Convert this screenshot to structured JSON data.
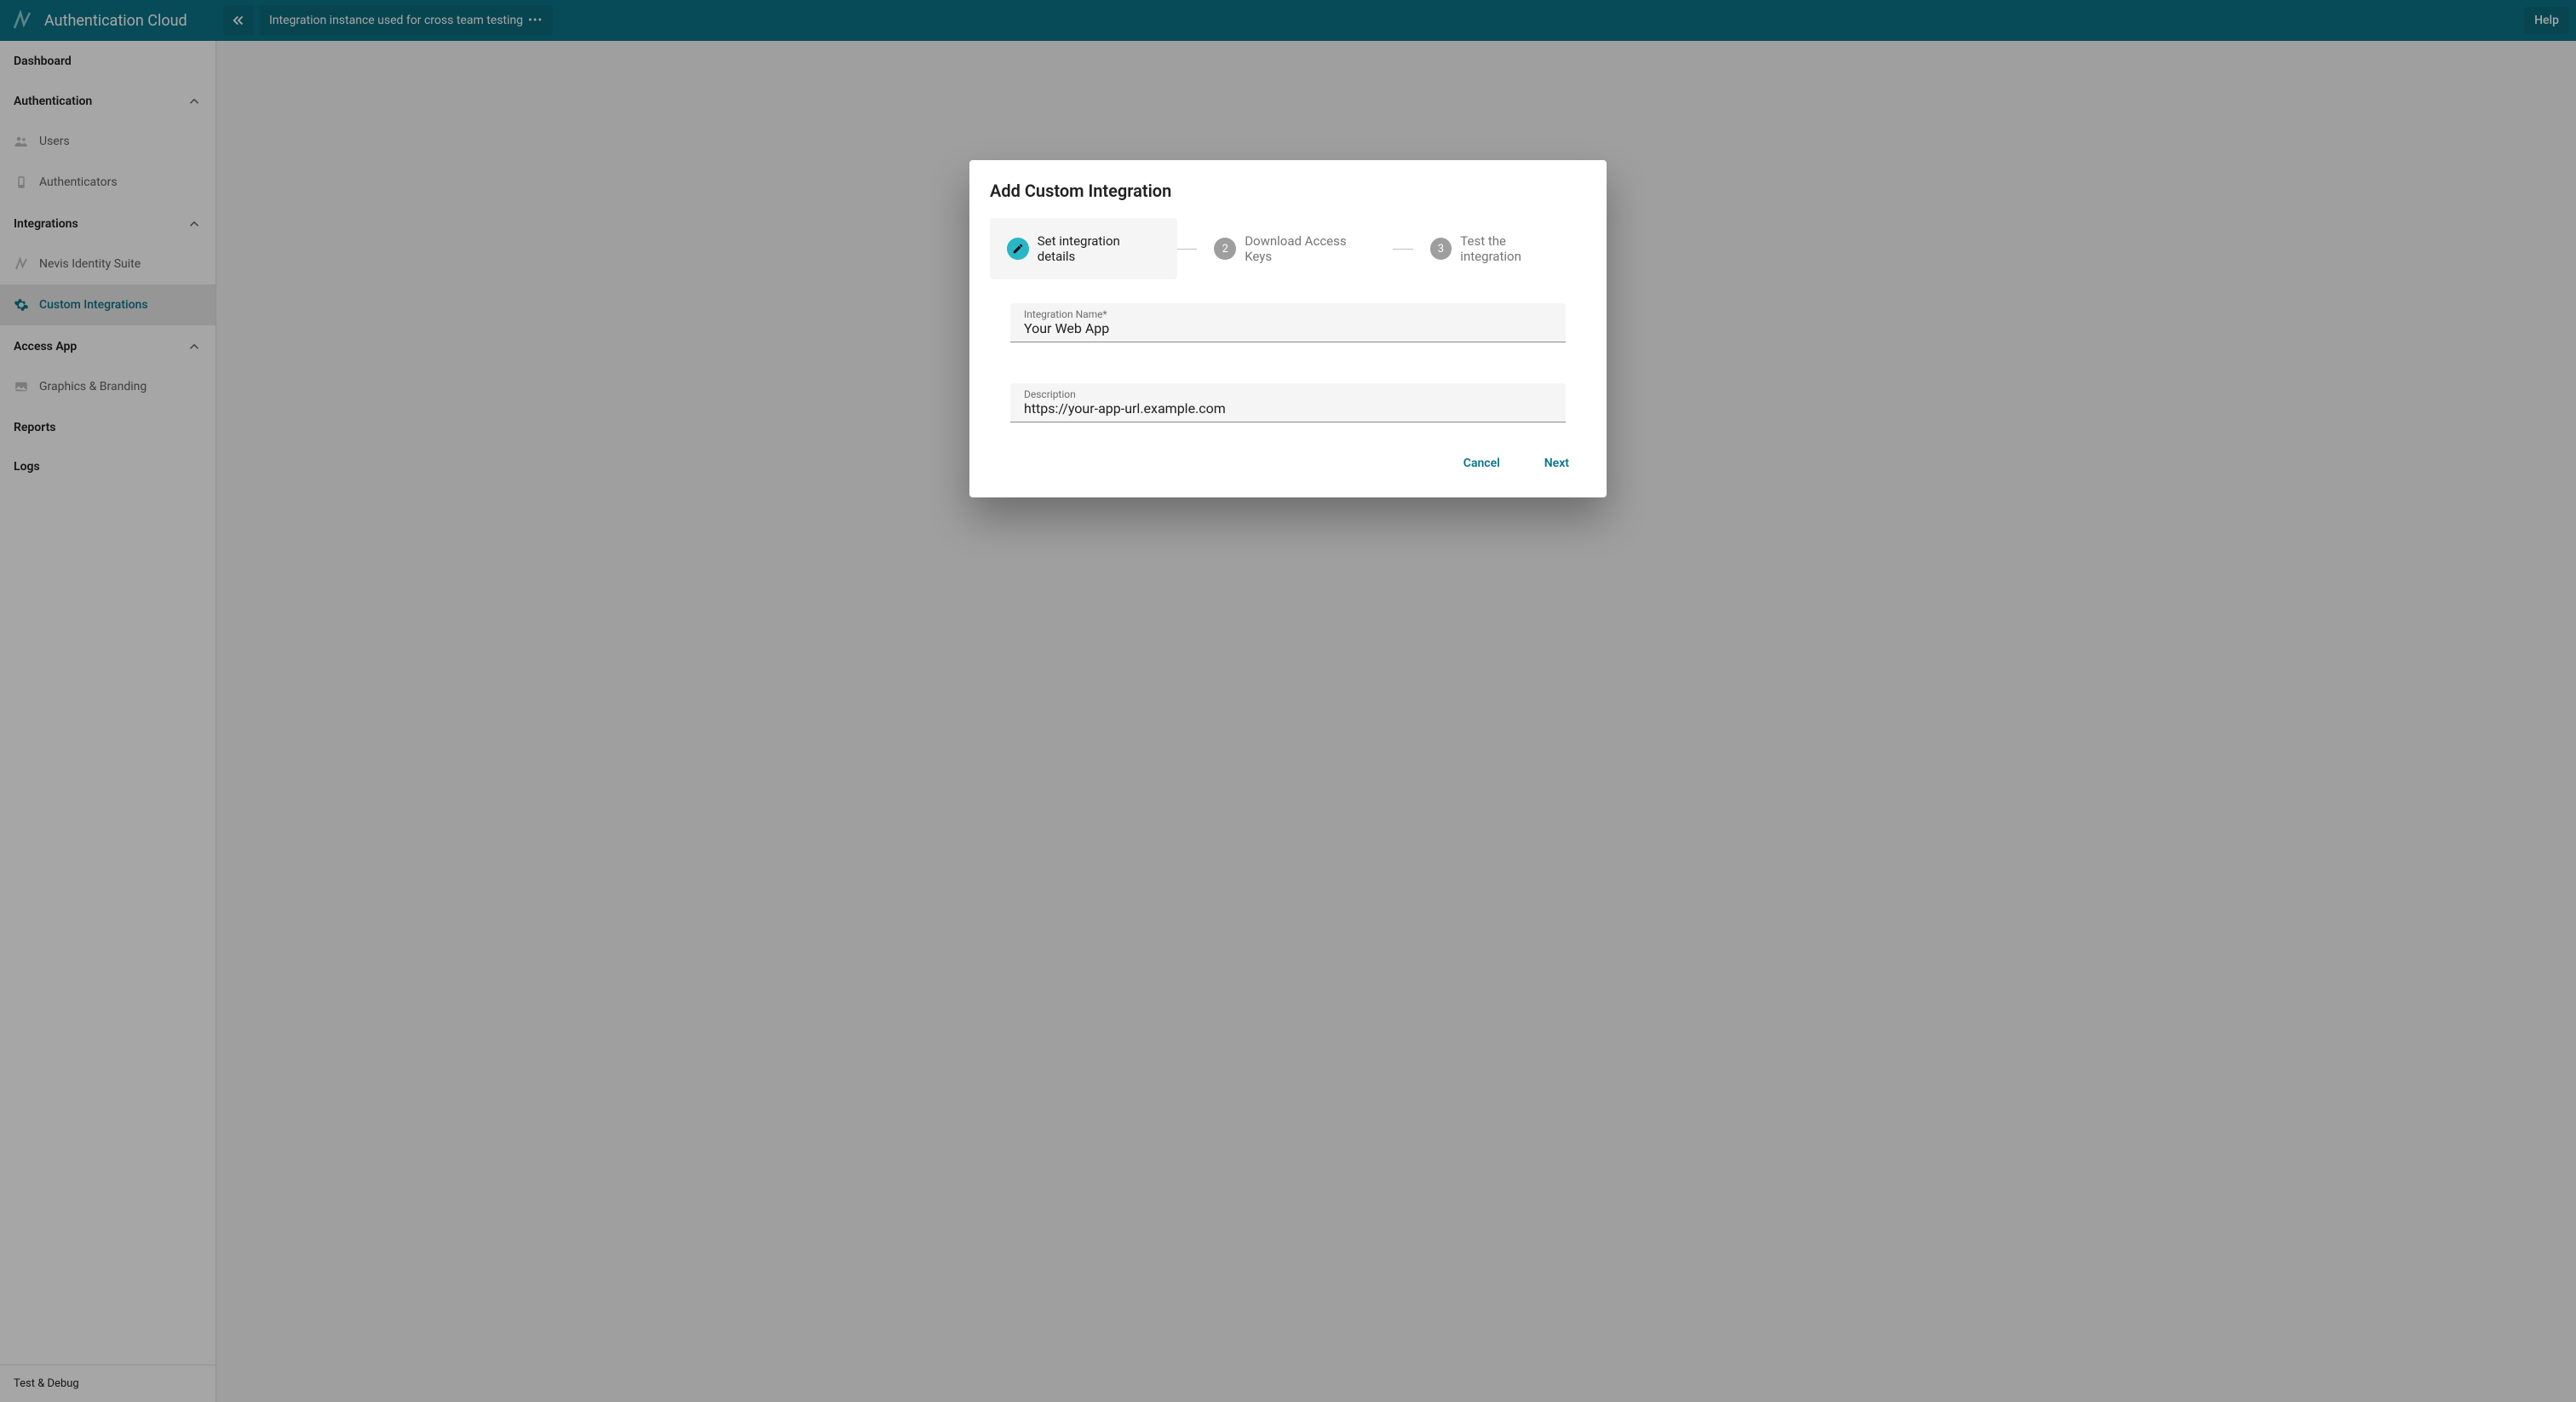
{
  "brand": {
    "name": "Authentication Cloud"
  },
  "topbar": {
    "instance_label": "Integration instance used for cross team testing",
    "help_label": "Help"
  },
  "sidebar": {
    "dashboard": "Dashboard",
    "authentication": "Authentication",
    "auth_items": [
      {
        "label": "Users"
      },
      {
        "label": "Authenticators"
      }
    ],
    "integrations": "Integrations",
    "integrations_items": [
      {
        "label": "Nevis Identity Suite"
      },
      {
        "label": "Custom Integrations",
        "active": true
      }
    ],
    "access_app": "Access App",
    "access_app_items": [
      {
        "label": "Graphics & Branding"
      }
    ],
    "reports": "Reports",
    "logs": "Logs",
    "footer": "Test & Debug"
  },
  "dialog": {
    "title": "Add Custom Integration",
    "steps": [
      {
        "label": "Set integration details",
        "state": "active"
      },
      {
        "badge": "2",
        "label": "Download Access Keys"
      },
      {
        "badge": "3",
        "label": "Test the integration"
      }
    ],
    "fields": {
      "name_label": "Integration Name*",
      "name_value": "Your Web App",
      "desc_label": "Description",
      "desc_value": "https://your-app-url.example.com"
    },
    "actions": {
      "cancel": "Cancel",
      "next": "Next"
    }
  }
}
